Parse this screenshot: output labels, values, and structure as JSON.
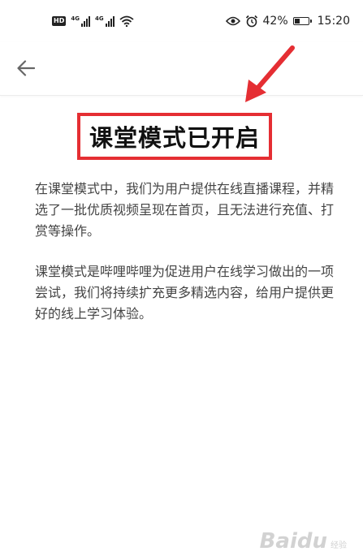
{
  "status_bar": {
    "hd": "HD",
    "signal_1_label": "4G",
    "signal_2_label": "4G",
    "battery_text": "42%",
    "battery_level": 0.42,
    "time": "15:20",
    "icons": [
      "eye-icon",
      "alarm-icon",
      "battery-icon",
      "wifi-icon",
      "signal-icon"
    ]
  },
  "nav": {
    "back_icon": "arrow-left-icon"
  },
  "main": {
    "title": "课堂模式已开启",
    "paragraphs": [
      "在课堂模式中，我们为用户提供在线直播课程，并精选了一批优质视频呈现在首页，且无法进行充值、打赏等操作。",
      "课堂模式是哔哩哔哩为促进用户在线学习做出的一项尝试，我们将持续扩充更多精选内容，给用户提供更好的线上学习体验。"
    ]
  },
  "annotation": {
    "highlight_color": "#e52e33"
  },
  "watermark": {
    "text": "Baidu",
    "sub": "经验"
  }
}
